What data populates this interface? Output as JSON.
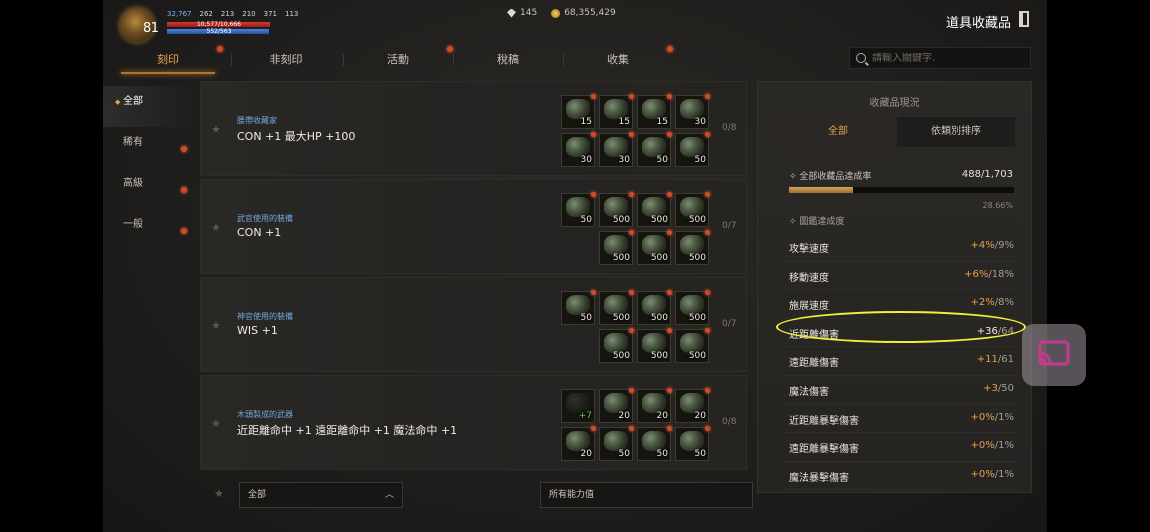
{
  "header": {
    "level": "81",
    "stats": [
      "32,767",
      "262",
      "213",
      "210",
      "371",
      "113"
    ],
    "hp": {
      "text": "10,577/10,666",
      "fraction": 0.99
    },
    "mp": {
      "text": "552/563",
      "fraction": 0.98
    },
    "gems": "145",
    "gold": "68,355,429",
    "title": "道具收藏品"
  },
  "tabs": [
    {
      "label": "刻印",
      "active": true,
      "badge": true
    },
    {
      "label": "非刻印",
      "active": false,
      "badge": false
    },
    {
      "label": "活動",
      "active": false,
      "badge": true
    },
    {
      "label": "稅稿",
      "active": false,
      "badge": false
    },
    {
      "label": "收集",
      "active": false,
      "badge": true
    }
  ],
  "search": {
    "placeholder": "請輸入關鍵字."
  },
  "sidebar": {
    "items": [
      {
        "label": "全部",
        "active": true,
        "badge": false
      },
      {
        "label": "稀有",
        "active": false,
        "badge": true
      },
      {
        "label": "高級",
        "active": false,
        "badge": true
      },
      {
        "label": "一般",
        "active": false,
        "badge": true
      }
    ]
  },
  "collections": [
    {
      "category": "腰帶收藏家",
      "effect": "CON +1 最大HP +100",
      "count": "0/8",
      "slots": [
        {
          "qty": "15"
        },
        {
          "qty": "15"
        },
        {
          "qty": "15"
        },
        {
          "qty": "30"
        },
        {
          "qty": "30"
        },
        {
          "qty": "30"
        },
        {
          "qty": "50"
        },
        {
          "qty": "50"
        }
      ]
    },
    {
      "category": "武官使用的裝備",
      "effect": "CON +1",
      "count": "0/7",
      "slots": [
        {
          "qty": "50"
        },
        {
          "qty": "500"
        },
        {
          "qty": "500"
        },
        {
          "qty": "500"
        },
        {
          "qty": "500"
        },
        {
          "qty": "500"
        },
        {
          "qty": "500"
        }
      ]
    },
    {
      "category": "神官使用的裝備",
      "effect": "WIS +1",
      "count": "0/7",
      "slots": [
        {
          "qty": "50"
        },
        {
          "qty": "500"
        },
        {
          "qty": "500"
        },
        {
          "qty": "500"
        },
        {
          "qty": "500"
        },
        {
          "qty": "500"
        },
        {
          "qty": "500"
        }
      ]
    },
    {
      "category": "木頭製成的武器",
      "effect": "近距離命中 +1 遠距離命中 +1 魔法命中 +1",
      "count": "0/8",
      "slots": [
        {
          "qty": "+7",
          "green": true
        },
        {
          "qty": "20"
        },
        {
          "qty": "20"
        },
        {
          "qty": "20"
        },
        {
          "qty": "20"
        },
        {
          "qty": "50"
        },
        {
          "qty": "50"
        },
        {
          "qty": "50"
        }
      ]
    }
  ],
  "filters": {
    "left": "全部",
    "right": "所有能力值"
  },
  "panel": {
    "title": "收藏品現況",
    "tabs": [
      "全部",
      "依類別排序"
    ],
    "rate_label": "全部收藏品達成率",
    "rate_value": "488/1,703",
    "rate_fraction": 0.2866,
    "rate_pct": "28.66%",
    "sub_label": "圖鑑達成度",
    "stats": [
      {
        "name": "攻擊速度",
        "cur": "+4%",
        "max": "/9%"
      },
      {
        "name": "移動速度",
        "cur": "+6%",
        "max": "/18%"
      },
      {
        "name": "施展速度",
        "cur": "+2%",
        "max": "/8%"
      },
      {
        "name": "近距離傷害",
        "cur": "+36",
        "max": "/64",
        "highlight": true
      },
      {
        "name": "遠距離傷害",
        "cur": "+11",
        "max": "/61"
      },
      {
        "name": "魔法傷害",
        "cur": "+3",
        "max": "/50"
      },
      {
        "name": "近距離暴擊傷害",
        "cur": "+0%",
        "max": "/1%"
      },
      {
        "name": "遠距離暴擊傷害",
        "cur": "+0%",
        "max": "/1%"
      },
      {
        "name": "魔法暴擊傷害",
        "cur": "+0%",
        "max": "/1%"
      }
    ]
  },
  "colors": {
    "accent": "#e6a552",
    "badge": "#d24a2a",
    "category": "#74a6dd",
    "highlight_ring": "#f4f03a"
  },
  "icons": {
    "cast": "cast-icon",
    "exit": "exit-icon",
    "search": "search-icon"
  }
}
